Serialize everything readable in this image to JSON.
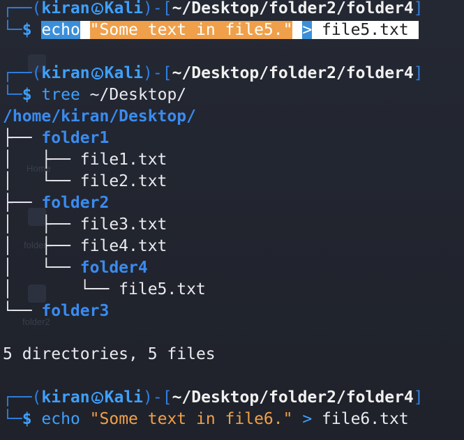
{
  "prompt": {
    "user": "kiran",
    "host": "Kali",
    "cwd": "~/Desktop/folder2/folder4",
    "symbol": "$"
  },
  "commands": {
    "cmd1": {
      "word": "echo",
      "string": "\"Some text in file5.\"",
      "operator": ">",
      "target": "file5.txt"
    },
    "cmd2": {
      "word": "tree",
      "arg": "~/Desktop/"
    },
    "cmd3": {
      "word": "echo",
      "string": "\"Some text in file6.\"",
      "operator": ">",
      "target": "file6.txt"
    }
  },
  "tree_output": {
    "root": "/home/kiran/Desktop/",
    "folder1": "folder1",
    "file1": "file1.txt",
    "file2": "file2.txt",
    "folder2": "folder2",
    "file3": "file3.txt",
    "file4": "file4.txt",
    "folder4": "folder4",
    "file5": "file5.txt",
    "folder3": "folder3",
    "summary": "5 directories, 5 files"
  },
  "desktop_ghosts": {
    "home": "Home",
    "folder": "folder",
    "folder2": "folder2"
  },
  "colors": {
    "background": "#23262e",
    "prompt_blue": "#3fa0ff",
    "string_orange": "#f0a04a",
    "selection_blue": "#3b8fd9"
  }
}
